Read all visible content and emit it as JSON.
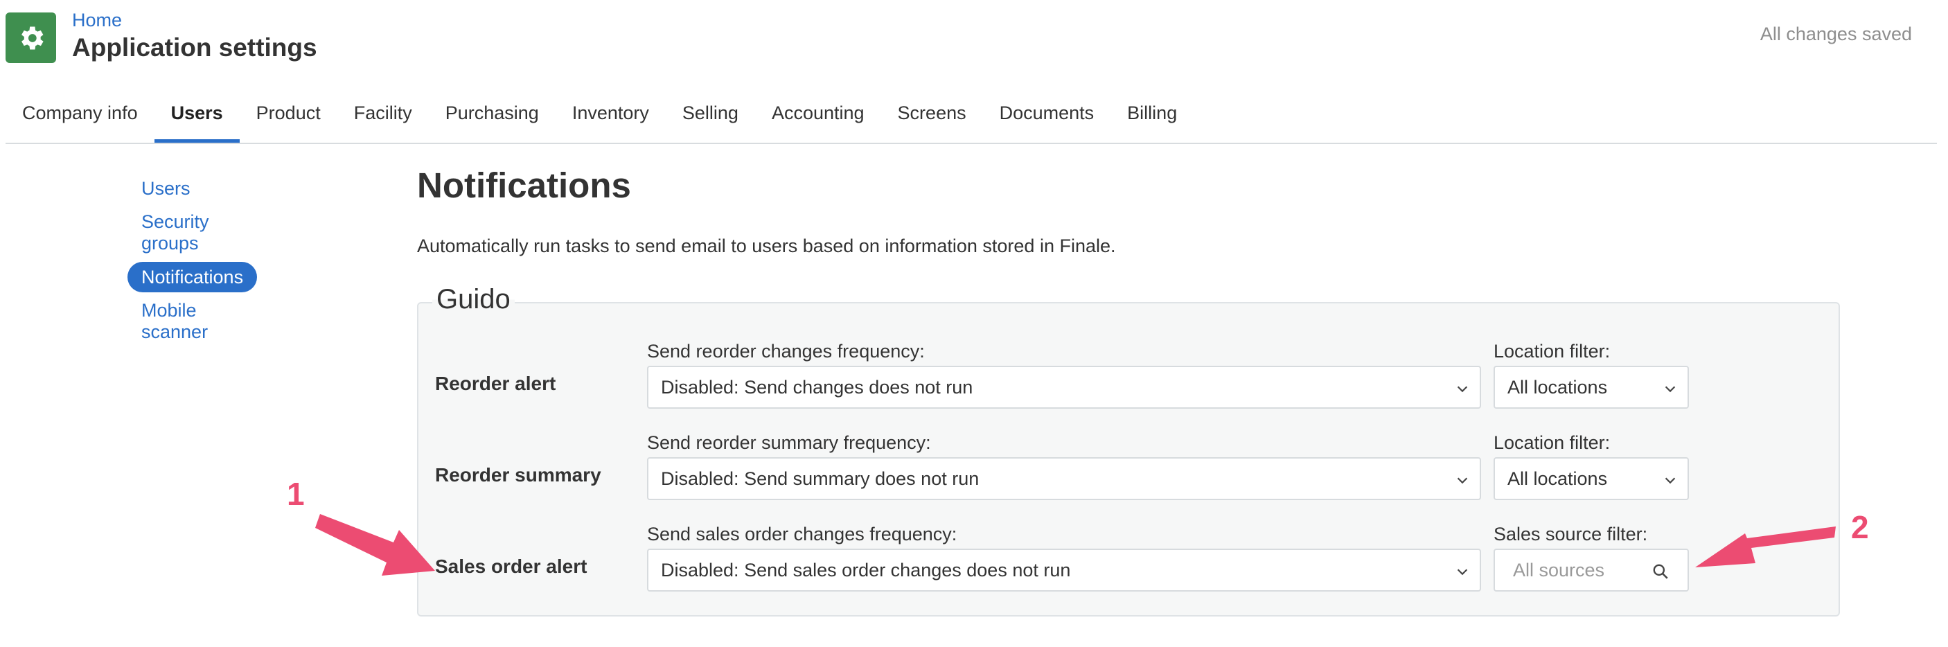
{
  "header": {
    "breadcrumb": "Home",
    "title": "Application settings",
    "save_status": "All changes saved",
    "app_icon": "gear-icon"
  },
  "tabs": [
    {
      "label": "Company info"
    },
    {
      "label": "Users",
      "active": true
    },
    {
      "label": "Product"
    },
    {
      "label": "Facility"
    },
    {
      "label": "Purchasing"
    },
    {
      "label": "Inventory"
    },
    {
      "label": "Selling"
    },
    {
      "label": "Accounting"
    },
    {
      "label": "Screens"
    },
    {
      "label": "Documents"
    },
    {
      "label": "Billing"
    }
  ],
  "sidebar": {
    "items": [
      {
        "label": "Users"
      },
      {
        "label": "Security groups"
      },
      {
        "label": "Notifications",
        "active": true
      },
      {
        "label": "Mobile scanner"
      }
    ]
  },
  "main": {
    "title": "Notifications",
    "description": "Automatically run tasks to send email to users based on information stored in Finale.",
    "panel": {
      "user_name": "Guido",
      "rows": [
        {
          "title": "Reorder alert",
          "frequency_label": "Send reorder changes frequency:",
          "frequency_value": "Disabled: Send changes does not run",
          "filter_label": "Location filter:",
          "filter_value": "All locations"
        },
        {
          "title": "Reorder summary",
          "frequency_label": "Send reorder summary frequency:",
          "frequency_value": "Disabled: Send summary does not run",
          "filter_label": "Location filter:",
          "filter_value": "All locations"
        },
        {
          "title": "Sales order alert",
          "frequency_label": "Send sales order changes frequency:",
          "frequency_value": "Disabled: Send sales order changes does not run",
          "filter_label": "Sales source filter:",
          "filter_placeholder": "All sources"
        }
      ]
    }
  },
  "annotations": {
    "marker_1": "1",
    "marker_2": "2",
    "color": "#ec4c72"
  },
  "colors": {
    "accent": "#2a6fc9",
    "app_icon_bg": "#3f8f4f",
    "panel_bg": "#f6f7f7"
  }
}
